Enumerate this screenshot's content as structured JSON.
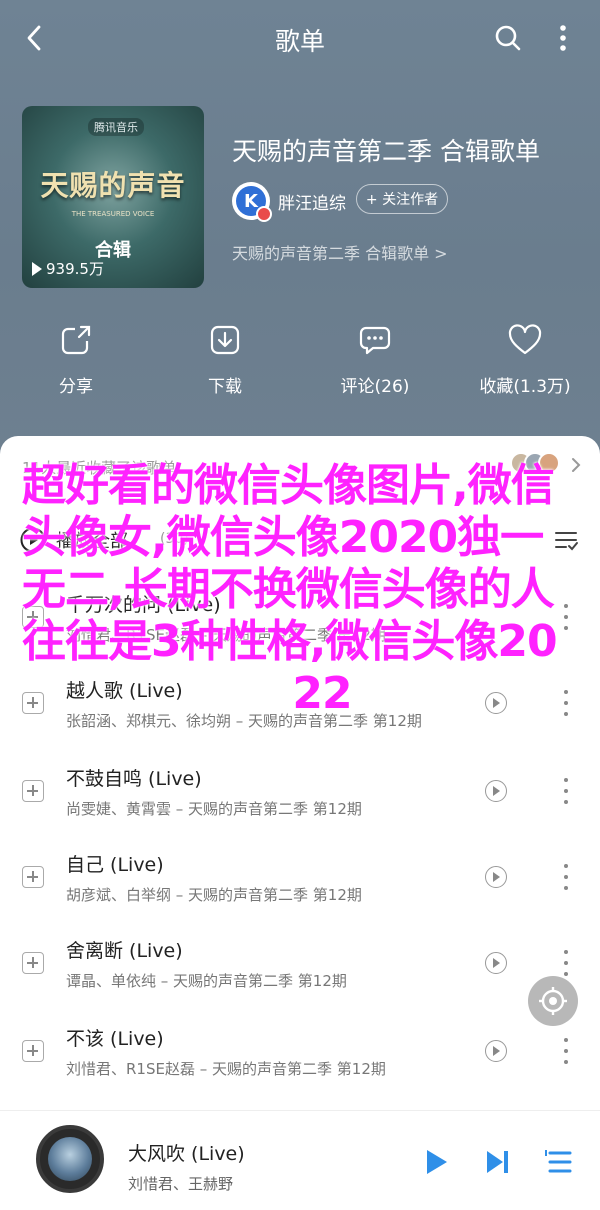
{
  "topbar": {
    "title": "歌单"
  },
  "cover": {
    "logo_text": "腾讯音乐",
    "main_text": "天赐的声音",
    "sub_text": "THE TREASURED VOICE",
    "tag": "合辑",
    "play_count": "939.5万"
  },
  "playlist": {
    "title": "天赐的声音第二季 合辑歌单",
    "author": "胖汪追综",
    "follow_label": "+ 关注作者",
    "desc": "天赐的声音第二季 合辑歌单 >"
  },
  "actions": [
    {
      "label": "分享",
      "icon": "share-icon"
    },
    {
      "label": "下载",
      "icon": "download-icon"
    },
    {
      "label": "评论(26)",
      "icon": "comment-icon"
    },
    {
      "label": "收藏(1.3万)",
      "icon": "heart-icon"
    }
  ],
  "recent": {
    "label": "11人最近收藏了该歌单"
  },
  "playall": {
    "label": "播放全部",
    "count": "(30)"
  },
  "songs": [
    {
      "title": "千万次的问 (Live)",
      "sub": "刘惜君、R1SE赵磊 – 天赐的声音第二季 第12期"
    },
    {
      "title": "越人歌 (Live)",
      "sub": "张韶涵、郑棋元、徐均朔 – 天赐的声音第二季 第12期"
    },
    {
      "title": "不鼓自鸣 (Live)",
      "sub": "尚雯婕、黄霄雲 – 天赐的声音第二季 第12期"
    },
    {
      "title": "自己 (Live)",
      "sub": "胡彦斌、白举纲 – 天赐的声音第二季 第12期"
    },
    {
      "title": "舍离断 (Live)",
      "sub": "谭晶、单依纯 – 天赐的声音第二季 第12期"
    },
    {
      "title": "不该 (Live)",
      "sub": "刘惜君、R1SE赵磊 – 天赐的声音第二季 第12期"
    }
  ],
  "overlay": {
    "text": "超好看的微信头像图片,微信头像女,微信头像2020独一无二,长期不换微信头像的人 往往是3种性格,微信头像20",
    "tail": "22"
  },
  "player": {
    "title": "大风吹 (Live)",
    "sub": "刘惜君、王赫野"
  },
  "colors": {
    "accent": "#2f8fe8",
    "overlay": "#ff22ff",
    "hero_bg": "#6c7f91"
  }
}
